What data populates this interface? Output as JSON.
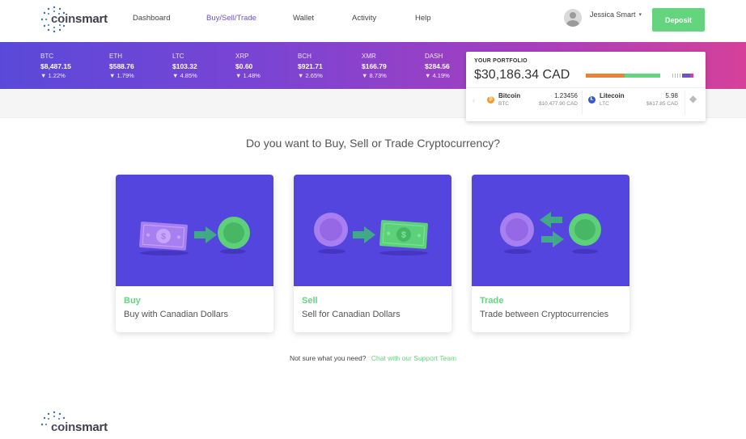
{
  "brand": {
    "logo_text_a": "coin",
    "logo_text_b": "smart"
  },
  "nav": {
    "links": [
      "Dashboard",
      "Buy/Sell/Trade",
      "Wallet",
      "Activity",
      "Help"
    ],
    "active": "Buy/Sell/Trade",
    "user_name": "Jessica Smart",
    "deposit_label": "Deposit"
  },
  "ticker": [
    {
      "symbol": "BTC",
      "price": "$8,487.15",
      "change": "1.22%"
    },
    {
      "symbol": "ETH",
      "price": "$588.76",
      "change": "1.79%"
    },
    {
      "symbol": "LTC",
      "price": "$103.32",
      "change": "4.85%"
    },
    {
      "symbol": "XRP",
      "price": "$0.60",
      "change": "1.48%"
    },
    {
      "symbol": "BCH",
      "price": "$921.71",
      "change": "2.65%"
    },
    {
      "symbol": "XMR",
      "price": "$166.79",
      "change": "8.73%"
    },
    {
      "symbol": "DASH",
      "price": "$284.56",
      "change": "4.19%"
    }
  ],
  "ticker_change_icon": "triangle-down-icon",
  "portfolio": {
    "label": "YOUR PORTFOLIO",
    "total": "$30,186.34 CAD",
    "allocation_colors": [
      "#e8823a",
      "#65d47f"
    ],
    "coins": [
      {
        "name": "Bitcoin",
        "symbol": "BTC",
        "amount": "1.23456",
        "value": "$10,477.90 CAD",
        "color": "#f39a2b",
        "glyph": "₿"
      },
      {
        "name": "Litecoin",
        "symbol": "LTC",
        "amount": "5.98",
        "value": "$617.85 CAD",
        "color": "#3457d6",
        "glyph": "Ł"
      }
    ],
    "prev_icon": "chevron-left-icon",
    "next_coin_icon": "ethereum-icon"
  },
  "main": {
    "headline": "Do you want to Buy, Sell or Trade Cryptocurrency?",
    "cards": [
      {
        "title": "Buy",
        "subtitle": "Buy with Canadian Dollars",
        "art": "cash-to-coin"
      },
      {
        "title": "Sell",
        "subtitle": "Sell for Canadian Dollars",
        "art": "coin-to-cash"
      },
      {
        "title": "Trade",
        "subtitle": "Trade between Cryptocurrencies",
        "art": "coin-swap"
      }
    ],
    "help_text": "Not sure what you need?",
    "help_link": "Chat with our Support Team"
  },
  "colors": {
    "accent_green": "#65d47f",
    "card_purple": "#5545df",
    "active_nav": "#6d52c9"
  }
}
